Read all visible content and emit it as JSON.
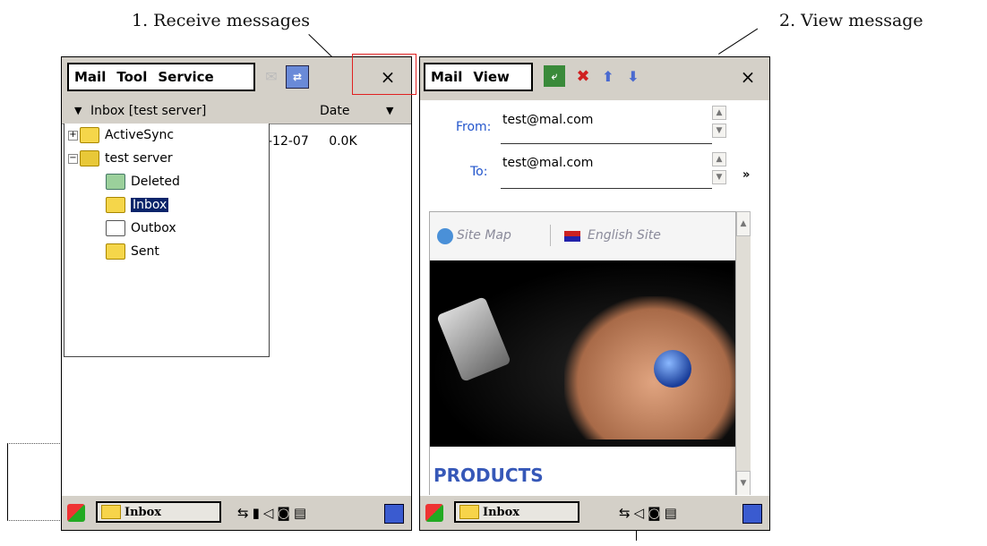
{
  "captions": {
    "receive": "1. Receive messages",
    "view": "2. View message"
  },
  "left_screen": {
    "menu": [
      "Mail",
      "Tool",
      "Service"
    ],
    "close_glyph": "×",
    "column_header": {
      "folder_label": "Inbox [test server]",
      "date_label": "Date"
    },
    "message_row": {
      "date": "-12-07",
      "size": "0.0K"
    },
    "tree": [
      {
        "label": "ActiveSync",
        "icon": "folder-icon",
        "expander": "+"
      },
      {
        "label": "test server",
        "icon": "server-folder-icon",
        "expander": "−"
      },
      {
        "label": "Deleted",
        "icon": "trash-icon"
      },
      {
        "label": "Inbox",
        "icon": "inbox-icon",
        "selected": true
      },
      {
        "label": "Outbox",
        "icon": "outbox-icon"
      },
      {
        "label": "Sent",
        "icon": "sent-icon"
      }
    ],
    "taskbar_label": "Inbox"
  },
  "right_screen": {
    "menu": [
      "Mail",
      "View"
    ],
    "close_glyph": "×",
    "from_label": "From:",
    "from_value": "test@mal.com",
    "to_label": "To:",
    "to_value": "test@mal.com",
    "web": {
      "site_map": "Site Map",
      "english_site": "English Site",
      "products": "PRODUCTS"
    },
    "taskbar_label": "Inbox"
  },
  "colors": {
    "highlight_box": "#e02020",
    "selection": "#0a246a",
    "chrome": "#d4d0c8"
  }
}
